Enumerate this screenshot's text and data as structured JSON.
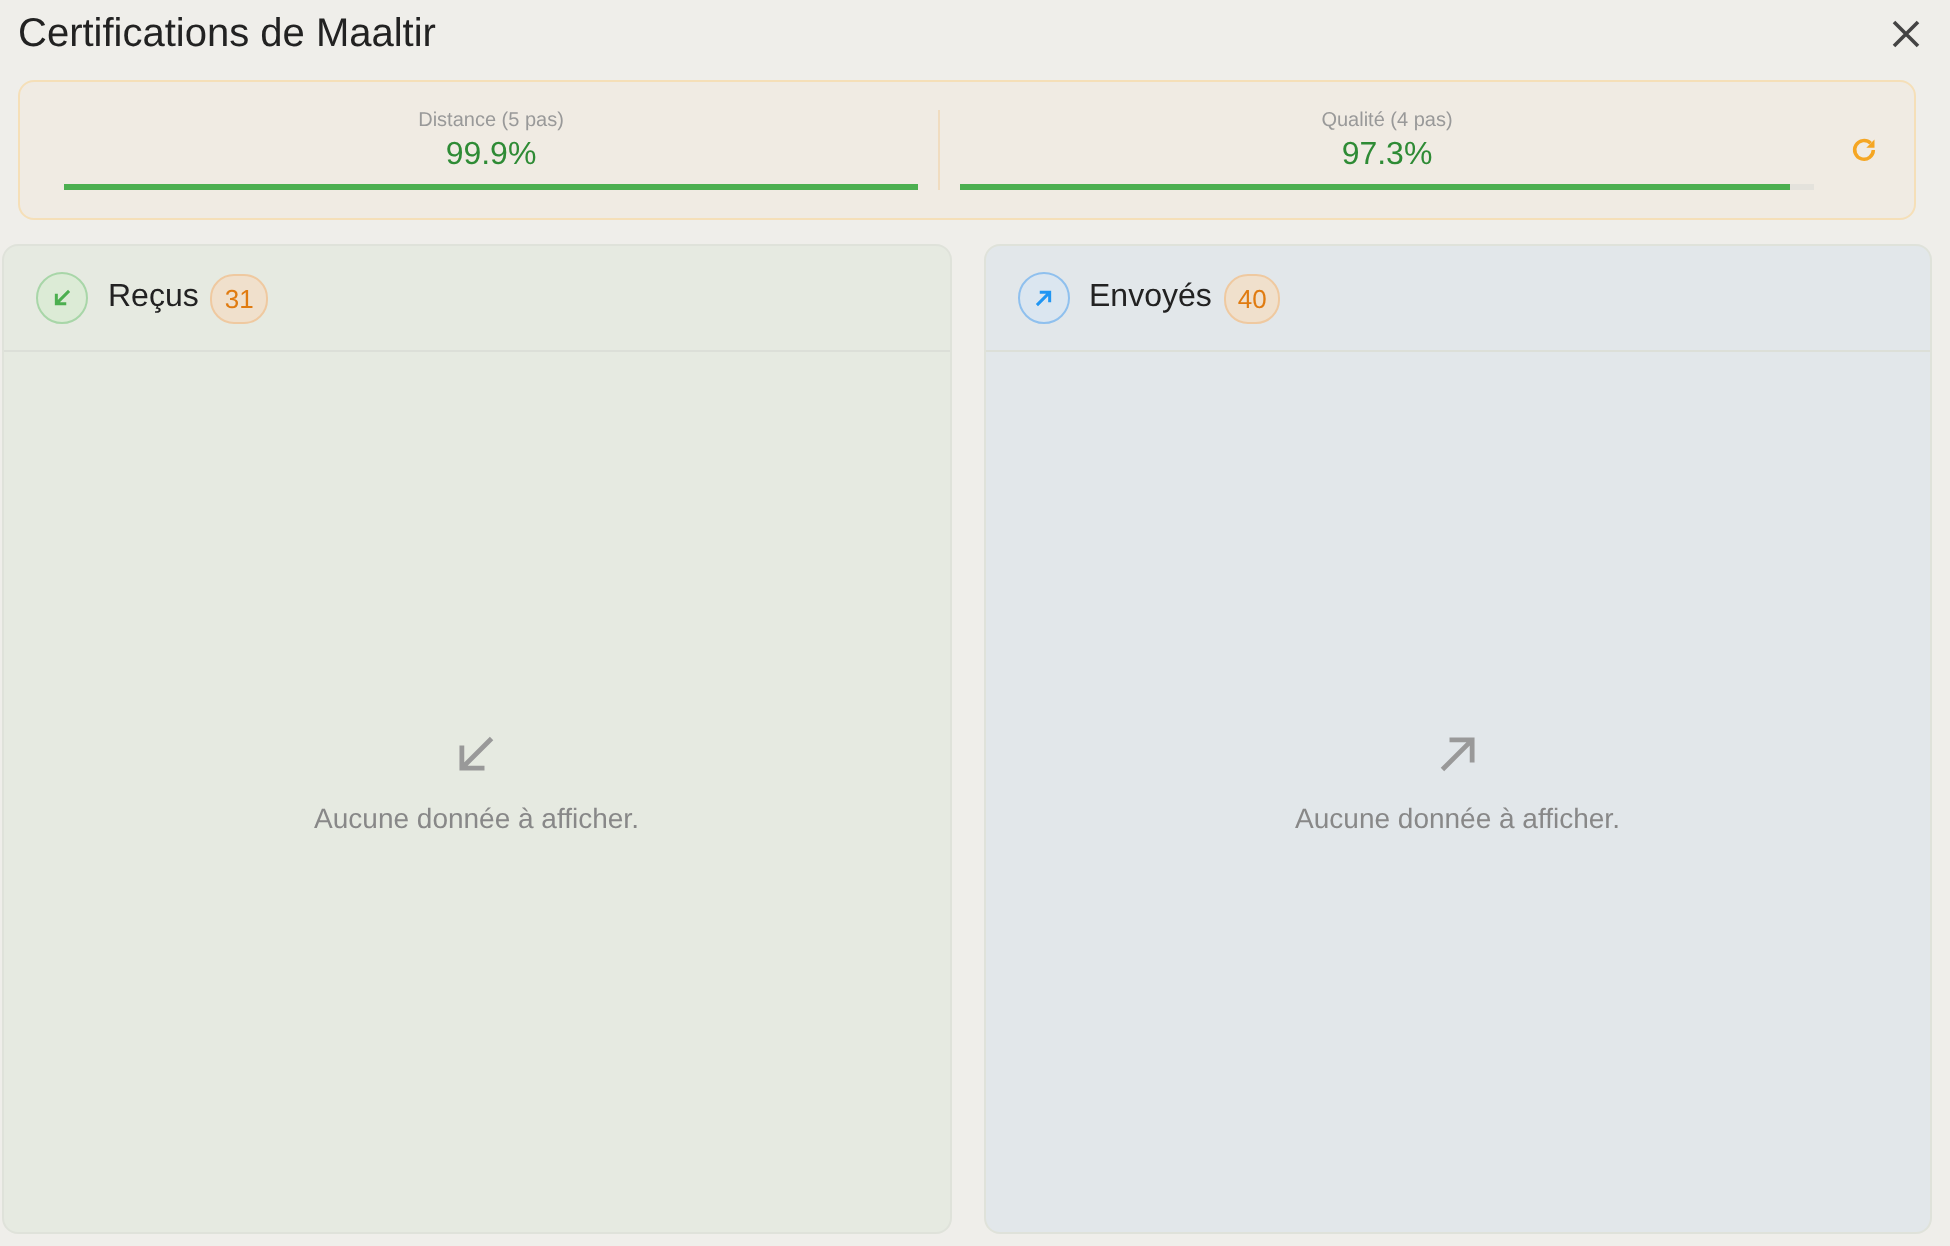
{
  "window": {
    "title": "Certifications de Maaltir"
  },
  "stats": [
    {
      "label": "Distance (5 pas)",
      "value": "99.9%",
      "level": 0.999
    },
    {
      "label": "Qualité (4 pas)",
      "value": "97.3%",
      "level": 0.973
    }
  ],
  "panels": [
    {
      "kind": "received",
      "title": "Reçus",
      "count": "31",
      "empty_message": "Aucune donnée à afficher."
    },
    {
      "kind": "sent",
      "title": "Envoyés",
      "count": "40",
      "empty_message": "Aucune donnée à afficher."
    }
  ]
}
